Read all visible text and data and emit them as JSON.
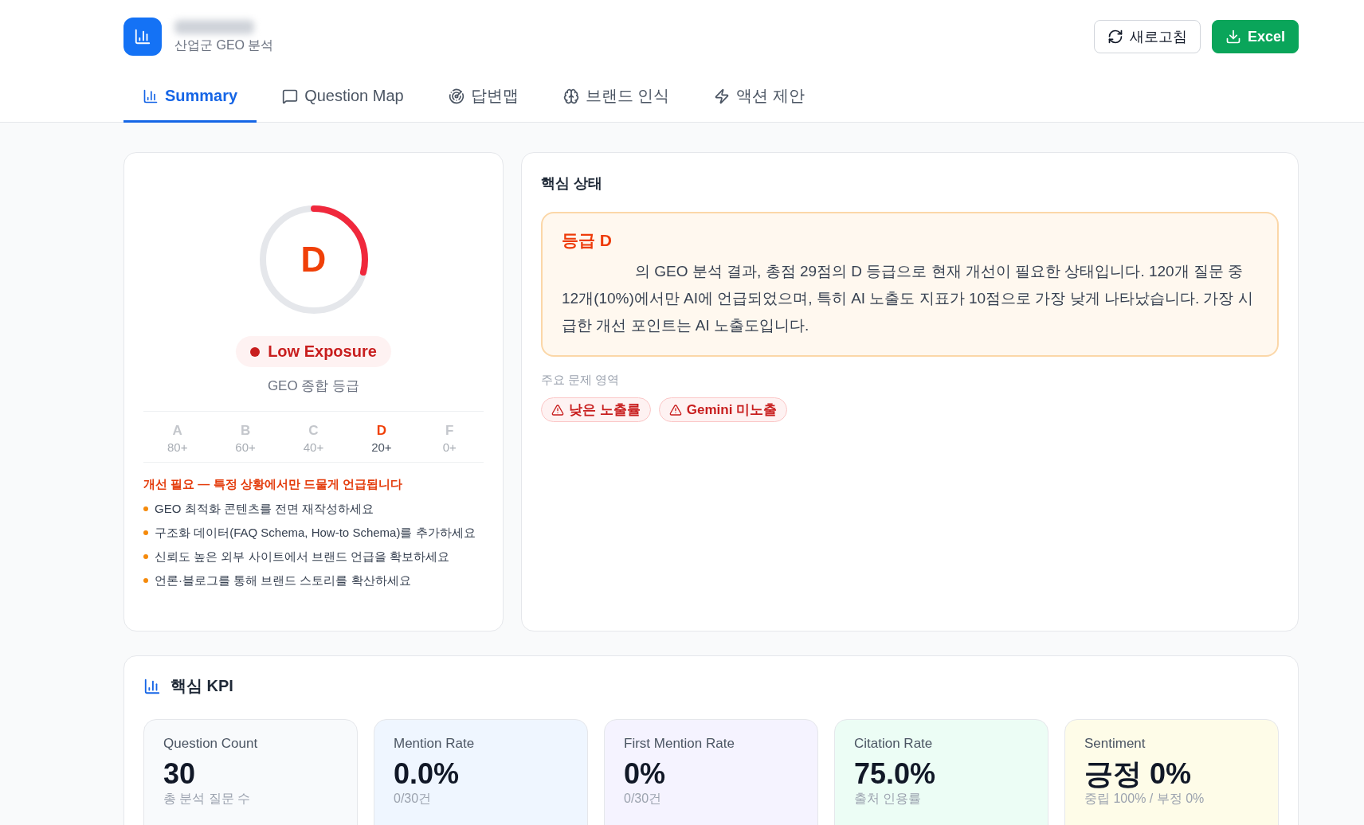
{
  "header": {
    "subtitle": "산업군 GEO 분석",
    "buttons": [
      {
        "kind": "refresh",
        "label": "새로고침"
      },
      {
        "kind": "download",
        "label": "Excel"
      }
    ]
  },
  "tabs": [
    {
      "label": "Summary",
      "selected": true
    },
    {
      "label": "Question Map",
      "selected": false
    },
    {
      "label": "답변맵",
      "selected": false
    },
    {
      "label": "브랜드 인식",
      "selected": false
    },
    {
      "label": "액션 제안",
      "selected": false
    }
  ],
  "grade_card": {
    "grade": "D",
    "level": 0.29,
    "badge": "Low Exposure",
    "caption": "GEO 종합 등급",
    "scale": [
      {
        "grade": "A",
        "threshold": "80+",
        "selected": false
      },
      {
        "grade": "B",
        "threshold": "60+",
        "selected": false
      },
      {
        "grade": "C",
        "threshold": "40+",
        "selected": false
      },
      {
        "grade": "D",
        "threshold": "20+",
        "selected": true
      },
      {
        "grade": "F",
        "threshold": "0+",
        "selected": false
      }
    ],
    "headline": "개선 필요 — 특정 상황에서만 드물게 언급됩니다",
    "tips": [
      "GEO 최적화 콘텐츠를 전면 재작성하세요",
      "구조화 데이터(FAQ Schema, How-to Schema)를 추가하세요",
      "신뢰도 높은 외부 사이트에서 브랜드 언급을 확보하세요",
      "언론·블로그를 통해 브랜드 스토리를 확산하세요"
    ]
  },
  "status_card": {
    "title": "핵심 상태",
    "alert_title": "등급 D",
    "alert_text": "의 GEO 분석 결과, 총점 29점의 D 등급으로 현재 개선이 필요한 상태입니다. 120개 질문 중 12개(10%)에서만 AI에 언급되었으며, 특히 AI 노출도 지표가 10점으로 가장 낮게 나타났습니다. 가장 시급한 개선 포인트는 AI 노출도입니다.",
    "issues_label": "주요 문제 영역",
    "issues": [
      "낮은 노출률",
      "Gemini 미노출"
    ]
  },
  "kpi": {
    "title": "핵심 KPI",
    "tiles": [
      {
        "label": "Question Count",
        "value": "30",
        "note": "총 분석 질문 수",
        "color": "#f8fafc"
      },
      {
        "label": "Mention Rate",
        "value": "0.0%",
        "note": "0/30건",
        "color": "#eff6ff"
      },
      {
        "label": "First Mention Rate",
        "value": "0%",
        "note": "0/30건",
        "color": "#f5f3ff"
      },
      {
        "label": "Citation Rate",
        "value": "75.0%",
        "note": "출처 인용률",
        "color": "#ecfdf5"
      },
      {
        "label": "Sentiment",
        "value": "긍정 0%",
        "note": "중립 100% / 부정 0%",
        "color": "#fefce8"
      }
    ]
  }
}
